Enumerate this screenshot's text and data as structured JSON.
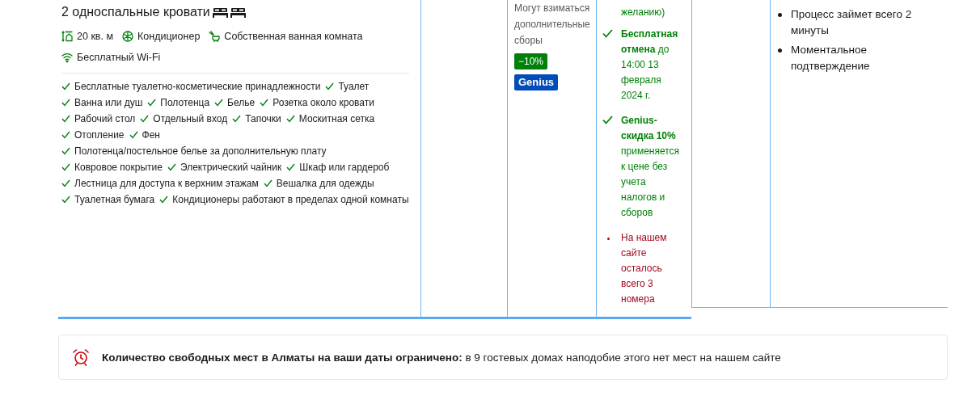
{
  "room": {
    "beds": "2 односпальные кровати",
    "highlights": [
      {
        "kind": "size",
        "label": "20 кв. м"
      },
      {
        "kind": "aircon",
        "label": "Кондиционер"
      },
      {
        "kind": "bathroom",
        "label": "Собственная ванная комната"
      },
      {
        "kind": "wifi",
        "label": "Бесплатный Wi-Fi"
      }
    ],
    "facilities": [
      [
        "Бесплатные туалетно-косметические принадлежности",
        "Туалет"
      ],
      [
        "Ванна или душ",
        "Полотенца",
        "Белье",
        "Розетка около кровати"
      ],
      [
        "Рабочий стол",
        "Отдельный вход",
        "Тапочки",
        "Москитная сетка"
      ],
      [
        "Отопление",
        "Фен"
      ],
      [
        "Полотенца/постельное белье за дополнительную плату"
      ],
      [
        "Ковровое покрытие",
        "Электрический чайник",
        "Шкаф или гардероб"
      ],
      [
        "Лестница для доступа к верхним этажам",
        "Вешалка для одежды"
      ],
      [
        "Туалетная бумага",
        "Кондиционеры работают в пределах одной комнаты"
      ]
    ]
  },
  "price": {
    "note": "Могут взиматься дополнительные сборы",
    "badges": [
      {
        "kind": "discount",
        "label": "−10%"
      },
      {
        "kind": "genius",
        "label": "Genius"
      }
    ]
  },
  "conditions": [
    {
      "kind": "text",
      "text": "желанию)"
    },
    {
      "kind": "check",
      "text": "**Бесплатная отмена** до 14:00 13 февраля 2024 г."
    },
    {
      "kind": "check",
      "text": "**Genius-скидка 10%** применяется к цене без учета налогов и сборов"
    },
    {
      "kind": "warning",
      "text": "На нашем сайте осталось всего 3 номера"
    }
  ],
  "benefits": [
    "Процесс займет всего 2 минуты",
    "Моментальное подтверждение"
  ],
  "alert": {
    "text": "**Количество свободных мест в Алматы на ваши даты ограничено:** в 9 гостевых домах наподобие этого нет мест на нашем сайте"
  }
}
